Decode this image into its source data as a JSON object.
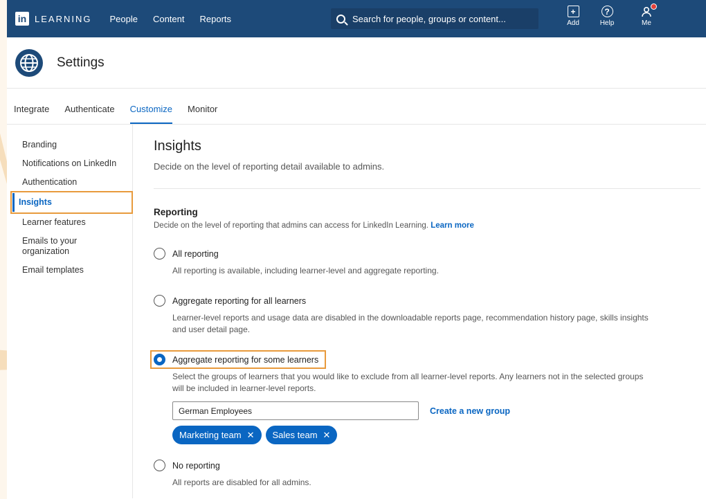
{
  "nav": {
    "logo_text": "LEARNING",
    "logo_mark": "in",
    "links": [
      "People",
      "Content",
      "Reports"
    ],
    "search_placeholder": "Search for people, groups or content...",
    "tools": [
      {
        "label": "Add",
        "icon": "add-icon"
      },
      {
        "label": "Help",
        "icon": "help-icon"
      },
      {
        "label": "Me",
        "icon": "user-icon"
      }
    ]
  },
  "settings": {
    "title": "Settings",
    "icon": "globe-icon"
  },
  "tabs": [
    "Integrate",
    "Authenticate",
    "Customize",
    "Monitor"
  ],
  "active_tab": "Customize",
  "sidebar": {
    "items": [
      "Branding",
      "Notifications on LinkedIn",
      "Authentication",
      "Insights",
      "Learner features",
      "Emails to your organization",
      "Email templates"
    ],
    "active": "Insights"
  },
  "main": {
    "title": "Insights",
    "subtitle": "Decide on the level of reporting detail available to admins.",
    "reporting": {
      "heading": "Reporting",
      "description": "Decide on the level of reporting that admins can access for LinkedIn Learning.",
      "learn_more": "Learn more",
      "options": [
        {
          "label": "All reporting",
          "help": "All reporting is available, including learner-level and aggregate reporting.",
          "checked": false
        },
        {
          "label": "Aggregate reporting for all learners",
          "help": "Learner-level reports and usage data are disabled in the downloadable reports page, recommendation history page, skills insights and user detail page.",
          "checked": false
        },
        {
          "label": "Aggregate reporting for some learners",
          "help": "Select the groups of learners that you would like to exclude from all learner-level reports. Any learners not in the selected groups will be included in learner-level reports.",
          "checked": true
        },
        {
          "label": "No reporting",
          "help": "All reports are disabled for all admins.",
          "checked": false
        }
      ],
      "group_input_value": "German Employees",
      "create_group": "Create a new group",
      "chips": [
        "Marketing team",
        "Sales team"
      ]
    }
  },
  "colors": {
    "nav_bg": "#1d4a79",
    "accent": "#0a66c2",
    "highlight": "#e89a3c"
  }
}
